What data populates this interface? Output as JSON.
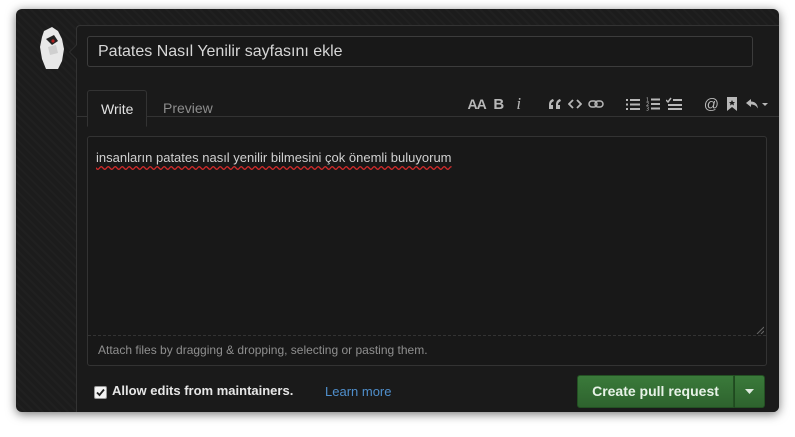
{
  "pr_form": {
    "title_value": "Patates Nasıl Yenilir sayfasını ekle",
    "tabs": [
      {
        "label": "Write"
      },
      {
        "label": "Preview"
      }
    ],
    "toolbar_icons": [
      "text-size-icon",
      "bold-icon",
      "italic-icon",
      "quote-icon",
      "code-icon",
      "link-icon",
      "unordered-list-icon",
      "ordered-list-icon",
      "task-list-icon",
      "mention-icon",
      "saved-reply-icon",
      "reply-icon"
    ],
    "toolbar_text": {
      "text_size": "AA",
      "bold": "B",
      "italic": "i",
      "mention": "@"
    },
    "body_text": "insanların patates nasıl yenilir bilmesini çok önemli buluyorum",
    "attach_hint": "Attach files by dragging & dropping, selecting or pasting them.",
    "allow_edits_label": "Allow edits from maintainers.",
    "allow_edits_checked": true,
    "learn_more": "Learn more",
    "submit_label": "Create pull request"
  },
  "colors": {
    "background": "#1c1c1c",
    "panel": "#1a1a1a",
    "text": "#d6d6d6",
    "link": "#4f8fcc",
    "button_green": "#357035",
    "spellcheck_underline": "#d12a2a"
  }
}
